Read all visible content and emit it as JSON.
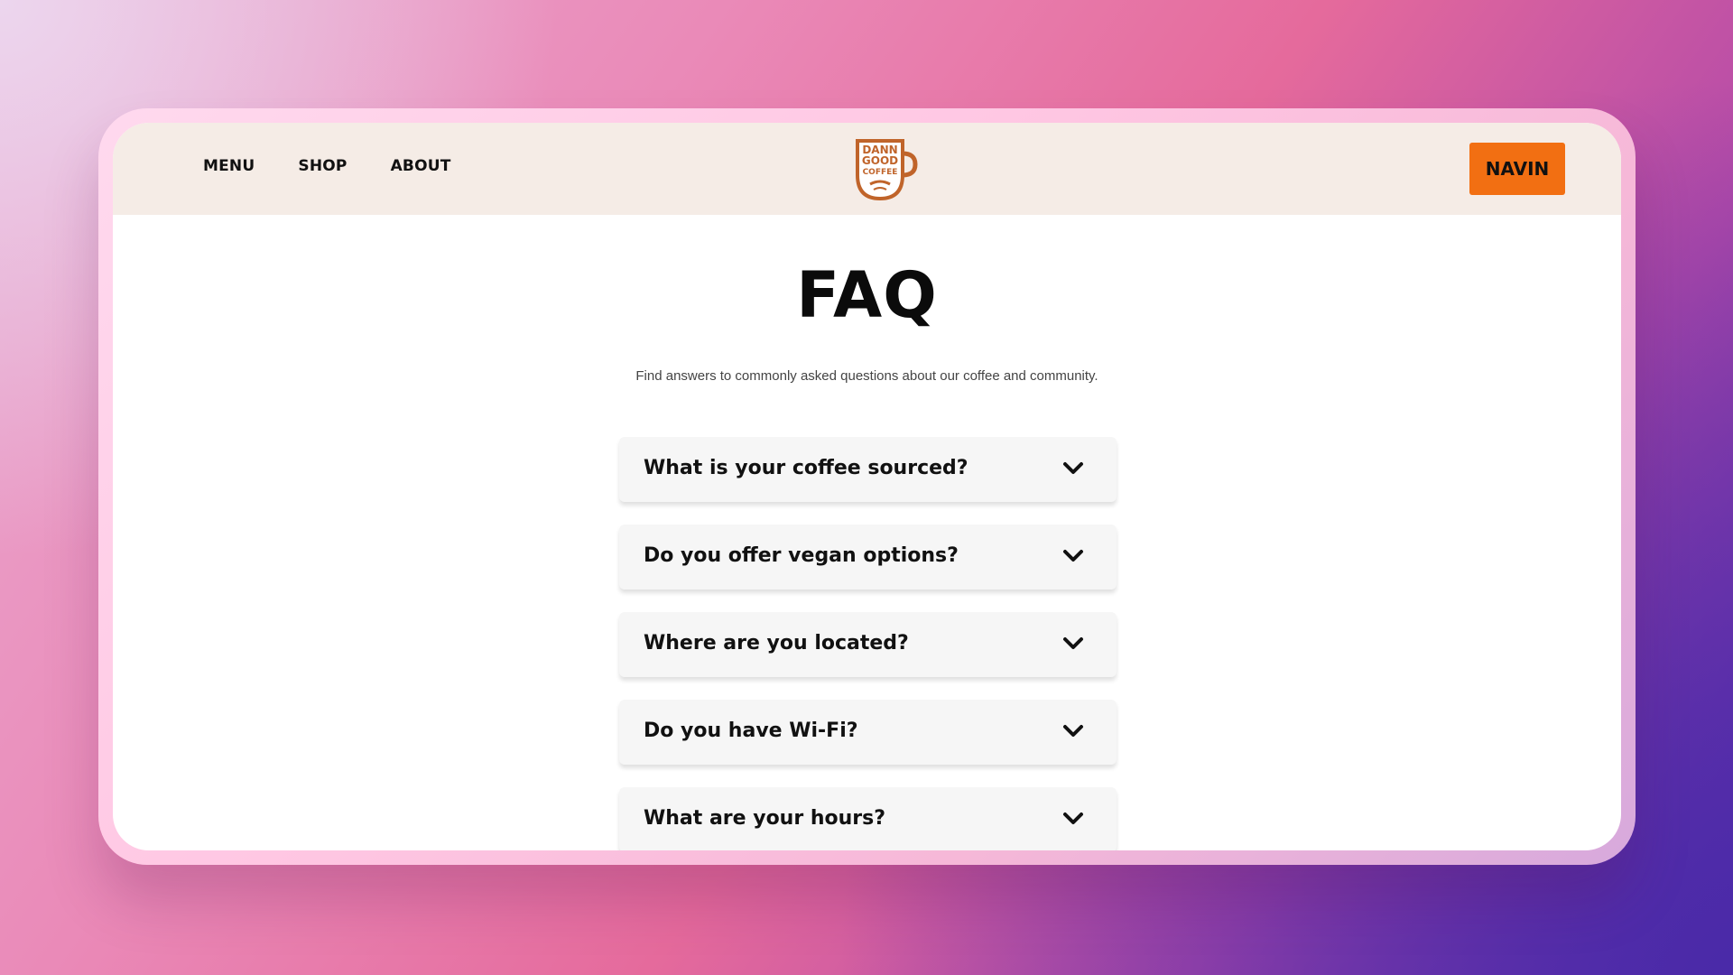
{
  "nav": {
    "links": [
      "MENU",
      "SHOP",
      "ABOUT"
    ],
    "cta_label": "NAVIN"
  },
  "logo": {
    "line1": "DANN",
    "line2": "GOOD",
    "line3": "COFFEE",
    "icon": "coffee-mug-logo-icon"
  },
  "page": {
    "title": "FAQ",
    "subtitle": "Find answers to commonly asked questions about our coffee and community."
  },
  "faq": {
    "items": [
      {
        "question": "What is your coffee sourced?"
      },
      {
        "question": "Do you offer vegan options?"
      },
      {
        "question": "Where are you located?"
      },
      {
        "question": "Do you have Wi-Fi?"
      },
      {
        "question": "What are your hours?"
      }
    ],
    "toggle_icon": "chevron-down-icon"
  },
  "colors": {
    "accent": "#f26f12",
    "navbar_bg": "#f5ece6",
    "logo_brown": "#c0642a",
    "text_dark": "#111111"
  }
}
